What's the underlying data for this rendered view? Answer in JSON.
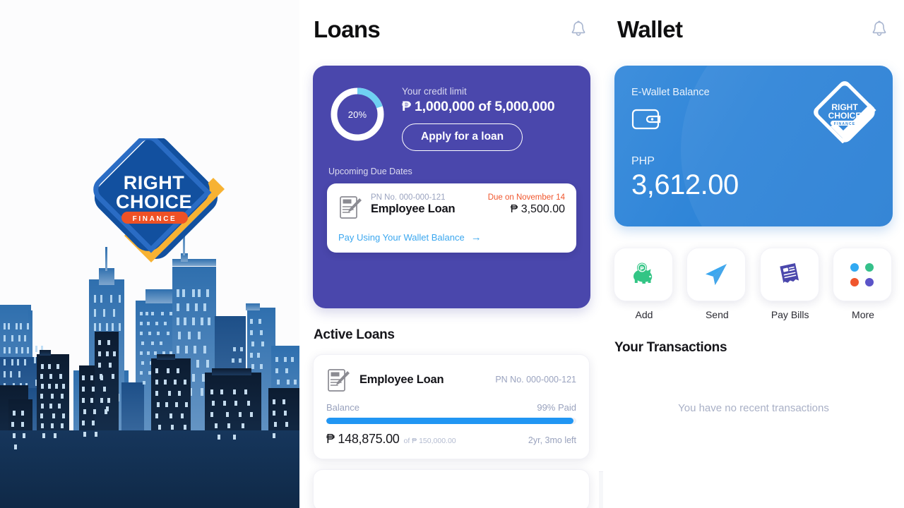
{
  "brand": {
    "logo_line1": "RIGHT",
    "logo_line2": "CHOICE",
    "logo_badge": "FINANCE"
  },
  "colors": {
    "loans_card_bg": "#4a47ac",
    "wallet_card_bg": "#2f85d8",
    "accent_blue": "#2196f3",
    "link_blue": "#3ba7ef",
    "due_orange": "#f0562d",
    "brand_blue": "#12509f",
    "brand_orange": "#ef5125",
    "brand_yellow": "#f7b233",
    "add_green": "#33c585",
    "more_dot_blue": "#31a9f2",
    "more_dot_green": "#35c08a",
    "more_dot_orange": "#f0562d",
    "more_dot_purple": "#5b54c8"
  },
  "loans": {
    "header": {
      "title": "Loans",
      "bell": "bell-icon"
    },
    "credit": {
      "percent_label": "20%",
      "percent_value": 20,
      "caption": "Your credit limit",
      "amount": "₱ 1,000,000 of 5,000,000",
      "apply_label": "Apply for a loan",
      "upcoming_label": "Upcoming Due Dates"
    },
    "due_item": {
      "pn": "PN No. 000-000-121",
      "name": "Employee Loan",
      "due_on": "Due on November 14",
      "amount": "₱ 3,500.00",
      "pay_link": "Pay Using Your Wallet Balance",
      "pay_arrow": "→"
    },
    "active_title": "Active Loans",
    "active_items": [
      {
        "name": "Employee Loan",
        "pn": "PN No. 000-000-121",
        "balance_label": "Balance",
        "paid_label": "99% Paid",
        "paid_percent": 99,
        "balance": "₱ 148,875.00",
        "of_total": "of ₱ 150,000.00",
        "term_left": "2yr, 3mo left"
      }
    ],
    "tabs": [
      {
        "name": "profile-tab",
        "icon": "person-icon",
        "active": false
      },
      {
        "name": "loans-tab",
        "icon": "cash-icon",
        "active": true
      },
      {
        "name": "reports-tab",
        "icon": "chart-icon",
        "active": false
      },
      {
        "name": "id-tab",
        "icon": "id-card-icon",
        "active": false
      },
      {
        "name": "account-tab",
        "icon": "person-icon",
        "active": false
      }
    ]
  },
  "wallet": {
    "header": {
      "title": "Wallet",
      "bell": "bell-icon"
    },
    "card": {
      "label": "E-Wallet Balance",
      "currency": "PHP",
      "amount": "3,612.00"
    },
    "actions": [
      {
        "label": "Add",
        "icon": "piggy-bank-icon"
      },
      {
        "label": "Send",
        "icon": "paper-plane-icon"
      },
      {
        "label": "Pay Bills",
        "icon": "bill-icon"
      },
      {
        "label": "More",
        "icon": "grid-dots-icon"
      }
    ],
    "transactions": {
      "title": "Your Transactions",
      "empty_message": "You have no recent transactions"
    },
    "tabs": [
      {
        "name": "wallet-tab",
        "icon": "wallet-icon",
        "active": true
      },
      {
        "name": "cash-tab",
        "icon": "cash-icon",
        "active": false
      },
      {
        "name": "reports-tab",
        "icon": "chart-icon",
        "active": false
      },
      {
        "name": "id-tab",
        "icon": "id-card-icon",
        "active": false
      },
      {
        "name": "account-tab",
        "icon": "person-icon",
        "active": false
      }
    ]
  }
}
